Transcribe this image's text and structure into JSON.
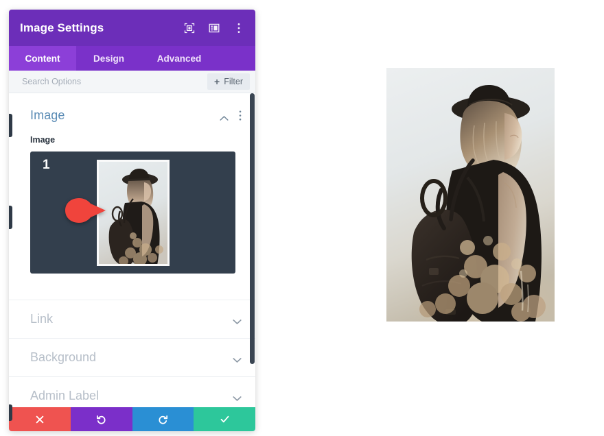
{
  "window": {
    "title": "Image Settings",
    "header_icons": [
      {
        "name": "focus-icon",
        "label": "Focus Mode"
      },
      {
        "name": "layout-icon",
        "label": "Panel Layout"
      },
      {
        "name": "kebab-menu-icon",
        "label": "More Options"
      }
    ]
  },
  "tabs": [
    {
      "label": "Content",
      "active": true
    },
    {
      "label": "Design",
      "active": false
    },
    {
      "label": "Advanced",
      "active": false
    }
  ],
  "search": {
    "placeholder": "Search Options",
    "value": "",
    "filter_label": "Filter",
    "filter_icon": "plus-icon"
  },
  "sections": [
    {
      "title": "Image",
      "expanded": true,
      "collapse_icon": "chevron-up-icon",
      "menu_icon": "kebab-menu-icon",
      "field_label": "Image",
      "callout": {
        "number": "1",
        "color": "#f0443c"
      }
    },
    {
      "title": "Link",
      "expanded": false,
      "collapse_icon": "chevron-down-icon"
    },
    {
      "title": "Background",
      "expanded": false,
      "collapse_icon": "chevron-down-icon"
    },
    {
      "title": "Admin Label",
      "expanded": false,
      "collapse_icon": "chevron-down-icon"
    }
  ],
  "footer": [
    {
      "name": "cancel-button",
      "icon": "close-icon",
      "color": "#ef5350"
    },
    {
      "name": "undo-button",
      "icon": "undo-icon",
      "color": "#7b2fc9"
    },
    {
      "name": "redo-button",
      "icon": "redo-icon",
      "color": "#2a8fd4"
    },
    {
      "name": "save-button",
      "icon": "check-icon",
      "color": "#2dc79b"
    }
  ],
  "preview": {
    "alt": "Woman wearing a black hat and tank top with a leather backpack, viewed from behind against a misty sky with warm bokeh"
  },
  "colors": {
    "header_purple": "#6c2eb9",
    "tab_bar_purple": "#7a31c9",
    "tab_active_purple": "#8c3fd8",
    "section_title_blue": "#5b8cb5",
    "collapsed_title_gray": "#b7bfc9",
    "preview_background": "#333f4d",
    "callout_red": "#f0443c"
  }
}
